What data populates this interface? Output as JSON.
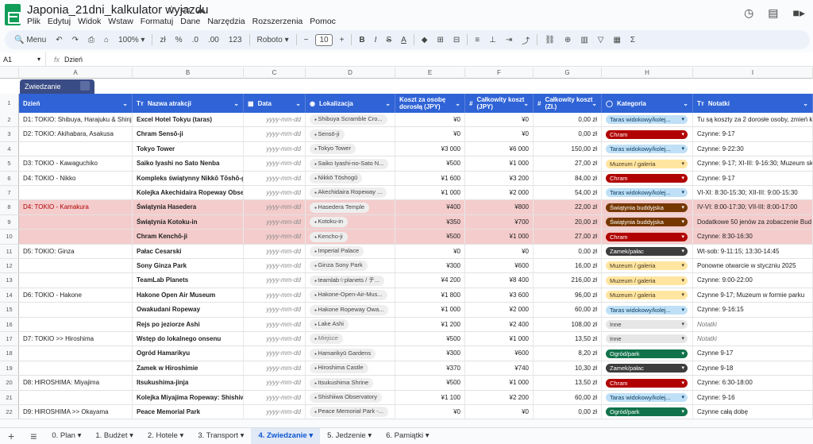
{
  "app": {
    "title": "Japonia_21dni_kalkulator wyjazdu",
    "menu": [
      "Plik",
      "Edytuj",
      "Widok",
      "Wstaw",
      "Formatuj",
      "Dane",
      "Narzędzia",
      "Rozszerzenia",
      "Pomoc"
    ]
  },
  "toolbar": {
    "menu_label": "Menu",
    "zoom": "100%",
    "currency": "zł",
    "percent": "%",
    "dec_less": ".0",
    "dec_more": ".00",
    "numfmt": "123",
    "font": "Roboto",
    "font_size": "10",
    "bold": "B",
    "italic": "I",
    "strike": "S",
    "text_color": "A",
    "sum": "Σ"
  },
  "formula_bar": {
    "cell": "A1",
    "fx": "fx",
    "value": "Dzień"
  },
  "columns": [
    "A",
    "B",
    "C",
    "D",
    "E",
    "F",
    "G",
    "H",
    "I"
  ],
  "table_chip": "Zwiedzanie",
  "headers": [
    "Dzień",
    "Nazwa atrakcji",
    "Data",
    "Lokalizacja",
    "Koszt za osobę dorosłą (JPY)",
    "Całkowity koszt (JPY)",
    "Całkowity koszt (Zł.)",
    "Kategoria",
    "Notatki"
  ],
  "header_icons": [
    "",
    "Tт",
    "▦",
    "◉",
    "",
    "#",
    "#",
    "◯",
    "Tт"
  ],
  "categories_colors": {
    "taras": "#bfe0f6",
    "chram": "#b10202",
    "muzeum": "#ffe5a0",
    "swiatynia": "#753800",
    "zamek": "#3d3d3d",
    "inne": "#e6e6e6",
    "ogrod": "#11734b"
  },
  "rows": [
    {
      "n": "2",
      "day": "D1: TOKIO: Shibuya, Harajuku & Shinjuku",
      "name": "Excel Hotel Tokyu (taras)",
      "date": "yyyy-mm-dd",
      "loc": "Shibuya Scramble Cro...",
      "cpp": "¥0",
      "tot": "¥0",
      "pln": "0,00 zł",
      "cat": "Taras widokowy/kolej...",
      "ck": "taras",
      "note": "Tu są koszty za 2 dorosłe osoby, zmień k",
      "hl": false,
      "italic_note": false
    },
    {
      "n": "3",
      "day": "D2: TOKIO: Akihabara, Asakusa",
      "name": "Chram Sensō-ji",
      "date": "yyyy-mm-dd",
      "loc": "Sensō-ji",
      "cpp": "¥0",
      "tot": "¥0",
      "pln": "0,00 zł",
      "cat": "Chram",
      "ck": "chram",
      "note": "Czynne: 9-17",
      "hl": false,
      "italic_note": false
    },
    {
      "n": "4",
      "day": "",
      "name": "Tokyo Tower",
      "date": "yyyy-mm-dd",
      "loc": "Tokyo Tower",
      "cpp": "¥3 000",
      "tot": "¥6 000",
      "pln": "150,00 zł",
      "cat": "Taras widokowy/kolej...",
      "ck": "taras",
      "note": "Czynne: 9-22:30",
      "hl": false,
      "italic_note": false
    },
    {
      "n": "5",
      "day": "D3: TOKIO - Kawaguchiko",
      "name": "Saiko Iyashi no Sato Nenba",
      "date": "yyyy-mm-dd",
      "loc": "Saiko Iyashi-no-Sato N...",
      "cpp": "¥500",
      "tot": "¥1 000",
      "pln": "27,00 zł",
      "cat": "Muzeum / galeria",
      "ck": "muzeum",
      "note": "Czynne: 9-17; XI-III: 9-16:30; Muzeum ska",
      "hl": false,
      "italic_note": false
    },
    {
      "n": "6",
      "day": "D4: TOKIO - Nikko",
      "name": "Kompleks świątynny Nikkō Tōshō-gū",
      "date": "yyyy-mm-dd",
      "loc": "Nikkō Tōshogū",
      "cpp": "¥1 600",
      "tot": "¥3 200",
      "pln": "84,00 zł",
      "cat": "Chram",
      "ck": "chram",
      "note": "Czynne: 9-17",
      "hl": false,
      "italic_note": false
    },
    {
      "n": "7",
      "day": "",
      "name": "Kolejka Akechidaira Ropeway Observ",
      "date": "yyyy-mm-dd",
      "loc": "Akechidaira Ropeway ...",
      "cpp": "¥1 000",
      "tot": "¥2 000",
      "pln": "54,00 zł",
      "cat": "Taras widokowy/kolej...",
      "ck": "taras",
      "note": "VI-XI: 8:30-15:30; XII-III: 9:00-15:30",
      "hl": false,
      "italic_note": false
    },
    {
      "n": "8",
      "day": "D4: TOKIO - Kamakura",
      "name": "Świątynia Hasedera",
      "date": "yyyy-mm-dd",
      "loc": "Hasedera Temple",
      "cpp": "¥400",
      "tot": "¥800",
      "pln": "22,00 zł",
      "cat": "Świątynia buddyjska",
      "ck": "swiatynia",
      "note": "IV-VI: 8:00-17:30; VII-III: 8:00-17:00",
      "hl": true,
      "italic_note": false
    },
    {
      "n": "9",
      "day": "",
      "name": "Świątynia Kotoku-in",
      "date": "yyyy-mm-dd",
      "loc": "Kotoku-in",
      "cpp": "¥350",
      "tot": "¥700",
      "pln": "20,00 zł",
      "cat": "Świątynia buddyjska",
      "ck": "swiatynia",
      "note": "Dodatkowe 50 jenów za zobaczenie Bud",
      "hl": true,
      "italic_note": false
    },
    {
      "n": "10",
      "day": "",
      "name": "Chram Kenchō-ji",
      "date": "yyyy-mm-dd",
      "loc": "Kencho-ji",
      "cpp": "¥500",
      "tot": "¥1 000",
      "pln": "27,00 zł",
      "cat": "Chram",
      "ck": "chram",
      "note": "Czynne: 8:30-16:30",
      "hl": true,
      "italic_note": false
    },
    {
      "n": "11",
      "day": "D5: TOKIO: Ginza",
      "name": "Pałac Cesarski",
      "date": "yyyy-mm-dd",
      "loc": "Imperial Palace",
      "cpp": "¥0",
      "tot": "¥0",
      "pln": "0,00 zł",
      "cat": "Zamek/pałac",
      "ck": "zamek",
      "note": "Wt-sob: 9-11:15; 13:30-14:45",
      "hl": false,
      "italic_note": false
    },
    {
      "n": "12",
      "day": "",
      "name": "Sony Ginza Park",
      "date": "yyyy-mm-dd",
      "loc": "Ginza Sony Park",
      "cpp": "¥300",
      "tot": "¥600",
      "pln": "16,00 zł",
      "cat": "Muzeum / galeria",
      "ck": "muzeum",
      "note": "Ponowne otwarcie w styczniu 2025",
      "hl": false,
      "italic_note": false
    },
    {
      "n": "13",
      "day": "",
      "name": "TeamLab Planets",
      "date": "yyyy-mm-dd",
      "loc": "teamlab☆planets / チ...",
      "cpp": "¥4 200",
      "tot": "¥8 400",
      "pln": "216,00 zł",
      "cat": "Muzeum / galeria",
      "ck": "muzeum",
      "note": "Czynne: 9:00-22:00",
      "hl": false,
      "italic_note": false
    },
    {
      "n": "14",
      "day": "D6: TOKIO - Hakone",
      "name": "Hakone Open Air Museum",
      "date": "yyyy-mm-dd",
      "loc": "Hakone-Open-Air-Mus...",
      "cpp": "¥1 800",
      "tot": "¥3 600",
      "pln": "96,00 zł",
      "cat": "Muzeum / galeria",
      "ck": "muzeum",
      "note": "Czynne 9-17; Muzeum w formie parku",
      "hl": false,
      "italic_note": false
    },
    {
      "n": "15",
      "day": "",
      "name": "Owakudani Ropeway",
      "date": "yyyy-mm-dd",
      "loc": "Hakone Ropeway Owa...",
      "cpp": "¥1 000",
      "tot": "¥2 000",
      "pln": "60,00 zł",
      "cat": "Taras widokowy/kolej...",
      "ck": "taras",
      "note": "Czynne: 9-16:15",
      "hl": false,
      "italic_note": false
    },
    {
      "n": "16",
      "day": "",
      "name": "Rejs po jeziorze Ashi",
      "date": "yyyy-mm-dd",
      "loc": "Lake Ashi",
      "cpp": "¥1 200",
      "tot": "¥2 400",
      "pln": "108,00 zł",
      "cat": "Inne",
      "ck": "inne",
      "note": "Notatki",
      "hl": false,
      "italic_note": true
    },
    {
      "n": "17",
      "day": "D7: TOKIO >> Hiroshima",
      "name": "Wstęp do lokalnego onsenu",
      "date": "yyyy-mm-dd",
      "loc": "Miejsce",
      "cpp": "¥500",
      "tot": "¥1 000",
      "pln": "13,50 zł",
      "cat": "Inne",
      "ck": "inne",
      "note": "Notatki",
      "hl": false,
      "italic_note": true
    },
    {
      "n": "18",
      "day": "",
      "name": "Ogród Hamarikyu",
      "date": "yyyy-mm-dd",
      "loc": "Hamarikyū Gardens",
      "cpp": "¥300",
      "tot": "¥600",
      "pln": "8,20 zł",
      "cat": "Ogród/park",
      "ck": "ogrod",
      "note": "Czynne 9-17",
      "hl": false,
      "italic_note": false
    },
    {
      "n": "19",
      "day": "",
      "name": "Zamek w Hiroshimie",
      "date": "yyyy-mm-dd",
      "loc": "Hiroshima Castle",
      "cpp": "¥370",
      "tot": "¥740",
      "pln": "10,30 zł",
      "cat": "Zamek/pałac",
      "ck": "zamek",
      "note": "Czynne 9-18",
      "hl": false,
      "italic_note": false
    },
    {
      "n": "20",
      "day": "D8: HIROSHIMA: Miyajima",
      "name": "Itsukushima-jinja",
      "date": "yyyy-mm-dd",
      "loc": "Itsukushima Shrine",
      "cpp": "¥500",
      "tot": "¥1 000",
      "pln": "13,50 zł",
      "cat": "Chram",
      "ck": "chram",
      "note": "Czynne: 6:30-18:00",
      "hl": false,
      "italic_note": false
    },
    {
      "n": "21",
      "day": "",
      "name": "Kolejka Miyajima Ropeway: Shishiwa",
      "date": "yyyy-mm-dd",
      "loc": "Shishiiwa Observatory",
      "cpp": "¥1 100",
      "tot": "¥2 200",
      "pln": "60,00 zł",
      "cat": "Taras widokowy/kolej...",
      "ck": "taras",
      "note": "Czynne: 9-16",
      "hl": false,
      "italic_note": false
    },
    {
      "n": "22",
      "day": "D9: HIROSHIMA >> Okayama",
      "name": "Peace Memorial Park",
      "date": "yyyy-mm-dd",
      "loc": "Peace Memorial Park -...",
      "cpp": "¥0",
      "tot": "¥0",
      "pln": "0,00 zł",
      "cat": "Ogród/park",
      "ck": "ogrod",
      "note": "Czynne całą dobę",
      "hl": false,
      "italic_note": false
    }
  ],
  "sheet_tabs": [
    "0. Plan",
    "1. Budżet",
    "2. Hotele",
    "3. Transport",
    "4. Zwiedzanie",
    "5. Jedzenie",
    "6. Pamiątki"
  ],
  "active_tab": "4. Zwiedzanie"
}
